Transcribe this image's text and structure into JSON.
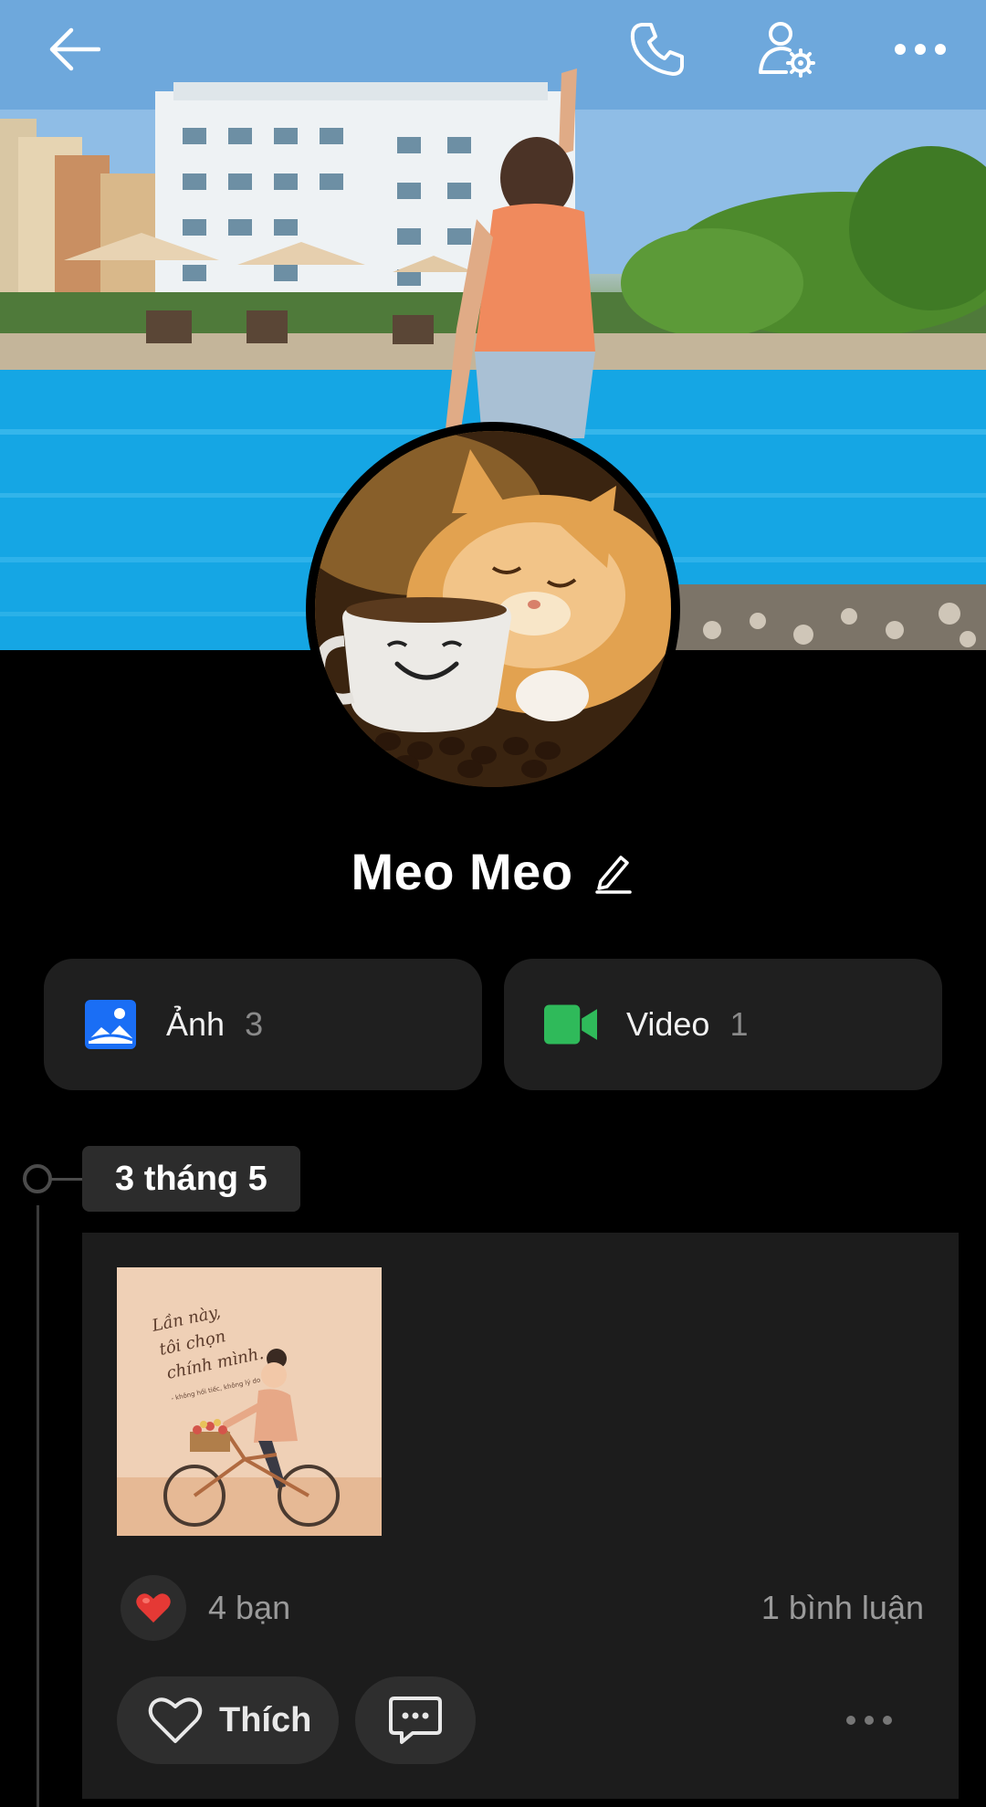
{
  "header": {
    "back_icon": "arrow-left-icon",
    "call_icon": "phone-icon",
    "settings_icon": "user-settings-icon",
    "more_icon": "more-horizontal-icon"
  },
  "profile": {
    "name": "Meo Meo",
    "edit_icon": "pencil-icon"
  },
  "media": {
    "photos": {
      "label": "Ảnh",
      "count": "3",
      "icon": "image-icon",
      "color": "#1a6ef5"
    },
    "videos": {
      "label": "Video",
      "count": "1",
      "icon": "video-camera-icon",
      "color": "#2fba5a"
    }
  },
  "timeline": {
    "date": "3 tháng 5"
  },
  "post": {
    "image_text": {
      "line1": "Lần này,",
      "line2": "tôi chọn",
      "line3": "chính mình.",
      "line4": "- không hối tiếc, không lý do -"
    },
    "reaction_icon": "heart-icon",
    "reaction_count": "4 bạn",
    "comment_count": "1 bình luận",
    "like_label": "Thích",
    "comment_icon": "comment-bubble-icon",
    "more_icon": "more-horizontal-icon"
  },
  "colors": {
    "background": "#000000",
    "card": "#1f1f1f",
    "heart": "#e53935"
  }
}
